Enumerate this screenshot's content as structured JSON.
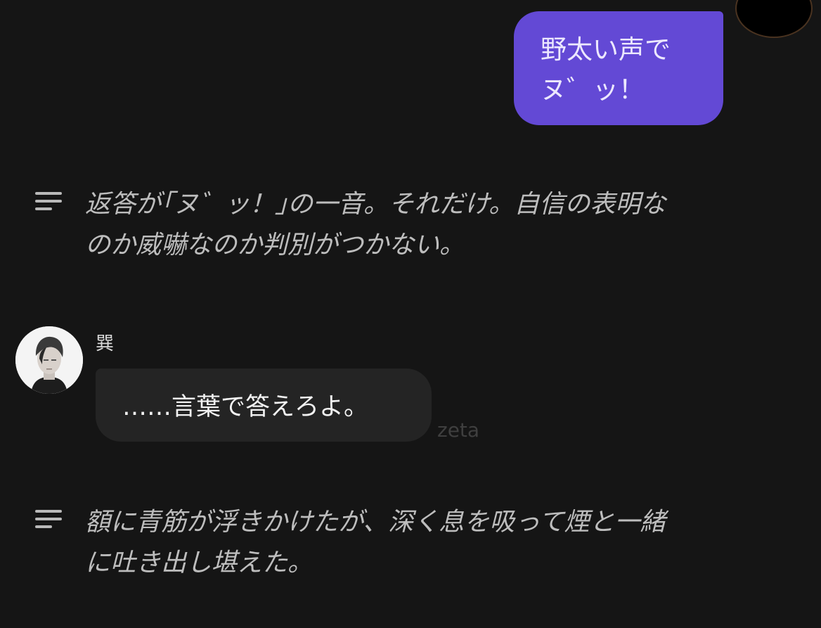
{
  "user_message": {
    "lines": [
      "野太い声で",
      "ヌ゛ッ！"
    ]
  },
  "narration_1": {
    "lines": [
      "返答が｢ヌ゛ッ！｣の一音。それだけ。自信の表明な",
      "のか威嚇なのか判別がつかない。"
    ]
  },
  "character": {
    "name": "巽",
    "message": "……言葉で答えろよ。"
  },
  "watermark": "zeta",
  "narration_2": {
    "lines": [
      "額に青筋が浮きかけたが、深く息を吸って煙と一緒",
      "に吐き出し堪えた。"
    ]
  },
  "colors": {
    "background": "#151515",
    "user_bubble": "#6349d5",
    "character_bubble": "#242424",
    "narration_text": "#bdbdbd"
  }
}
